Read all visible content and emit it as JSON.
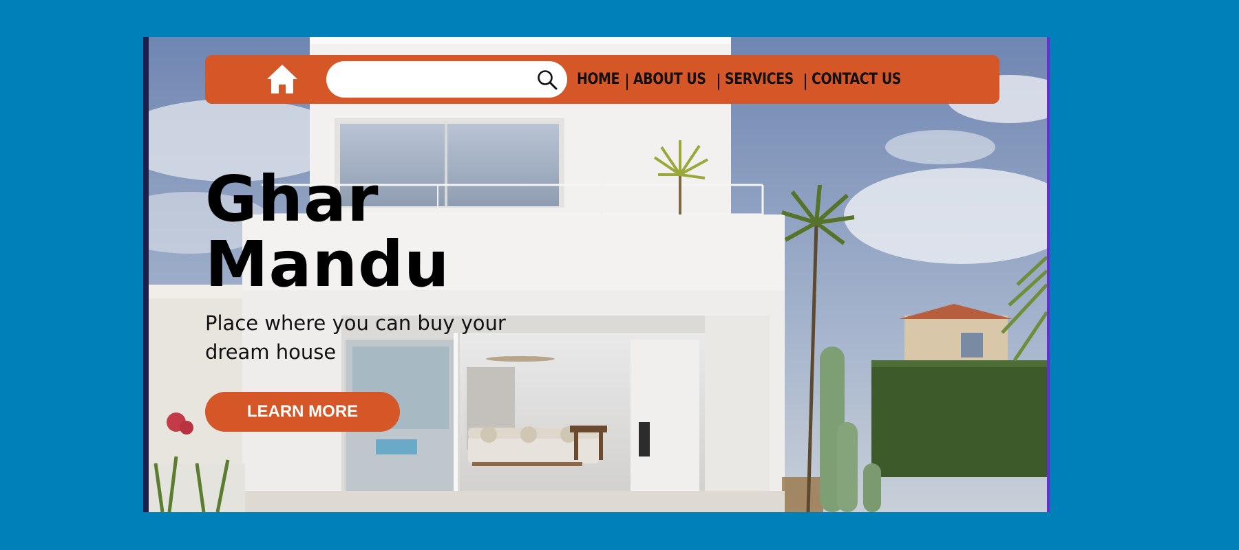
{
  "colors": {
    "page_background": "#0080b8",
    "accent": "#d55627",
    "search_background": "#ffffff",
    "text": "#111111",
    "cta_text": "#ffffff"
  },
  "nav": {
    "home_icon": "home-icon",
    "search": {
      "value": "",
      "placeholder": "",
      "icon": "search-icon"
    },
    "links": [
      {
        "label": "HOME"
      },
      {
        "label": "ABOUT US"
      },
      {
        "label": "SERVICES"
      },
      {
        "label": "CONTACT US"
      }
    ]
  },
  "hero": {
    "title_line1": "Ghar",
    "title_line2": "Mandu",
    "subtitle": "Place where you can buy your dream house",
    "cta_label": "LEARN MORE"
  }
}
